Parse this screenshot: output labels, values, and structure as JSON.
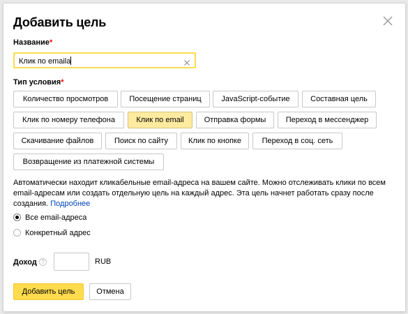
{
  "dialog": {
    "title": "Добавить цель",
    "close_icon": "close-icon"
  },
  "name_field": {
    "label": "Название",
    "required_mark": "*",
    "value": "Клик по emaila",
    "clear_icon": "clear-icon"
  },
  "condition": {
    "label": "Тип условия",
    "required_mark": "*",
    "options": [
      "Количество просмотров",
      "Посещение страниц",
      "JavaScript-событие",
      "Составная цель",
      "Клик по номеру телефона",
      "Клик по email",
      "Отправка формы",
      "Переход в мессенджер",
      "Скачивание файлов",
      "Поиск по сайту",
      "Клик по кнопке",
      "Переход в соц. сеть",
      "Возвращение из платежной системы"
    ],
    "selected": "Клик по email",
    "selected_color": "#ffeba0"
  },
  "description": {
    "text": "Автоматически находит кликабельные email-адреса на вашем сайте. Можно отслеживать клики по всем email-адресам или создать отдельную цель на каждый адрес. Эта цель начнет работать сразу после создания.",
    "link": "Подробнее",
    "link_color": "#0044bb"
  },
  "address_mode": {
    "options": [
      "Все email-адреса",
      "Конкретный адрес"
    ],
    "selected": "Все email-адреса"
  },
  "income": {
    "label": "Доход",
    "help_icon": "question-icon",
    "help_glyph": "?",
    "value": "",
    "currency": "RUB"
  },
  "actions": {
    "submit": "Добавить цель",
    "cancel": "Отмена",
    "accent_color": "#ffdb4d"
  }
}
